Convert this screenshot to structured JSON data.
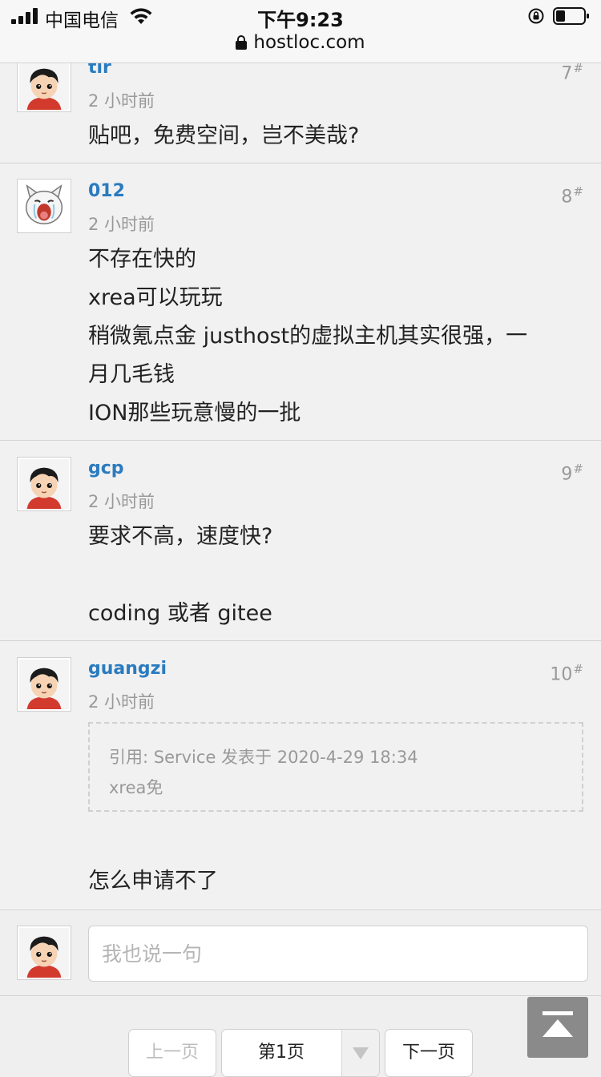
{
  "status_bar": {
    "carrier": "中国电信",
    "time": "下午9:23"
  },
  "address_bar": {
    "url": "hostloc.com"
  },
  "posts": [
    {
      "username": "tlr",
      "time": "2 小时前",
      "floor": "7",
      "floor_mark": "#",
      "avatar": "cartoon-boy-avatar",
      "lines": [
        "贴吧，免费空间，岂不美哉?"
      ]
    },
    {
      "username": "012",
      "time": "2 小时前",
      "floor": "8",
      "floor_mark": "#",
      "avatar": "crying-cat-avatar",
      "lines": [
        "不存在快的",
        "xrea可以玩玩",
        "稍微氪点金 justhost的虚拟主机其实很强，一",
        "月几毛钱",
        "ION那些玩意慢的一批"
      ]
    },
    {
      "username": "gcp",
      "time": "2 小时前",
      "floor": "9",
      "floor_mark": "#",
      "avatar": "cartoon-boy-avatar",
      "lines": [
        "要求不高，速度快?",
        "coding 或者 gitee"
      ]
    },
    {
      "username": "guangzi",
      "time": "2 小时前",
      "floor": "10",
      "floor_mark": "#",
      "avatar": "cartoon-boy-avatar",
      "quote": {
        "header": "引用: Service 发表于 2020-4-29 18:34",
        "text": "xrea免"
      },
      "lines": [
        "怎么申请不了"
      ]
    }
  ],
  "reply": {
    "placeholder": "我也说一句"
  },
  "pager": {
    "prev": "上一页",
    "current": "第1页",
    "next": "下一页"
  },
  "colors": {
    "username": "#2a7bbf",
    "background": "#efefef",
    "back_to_top": "#8a8a8a"
  }
}
